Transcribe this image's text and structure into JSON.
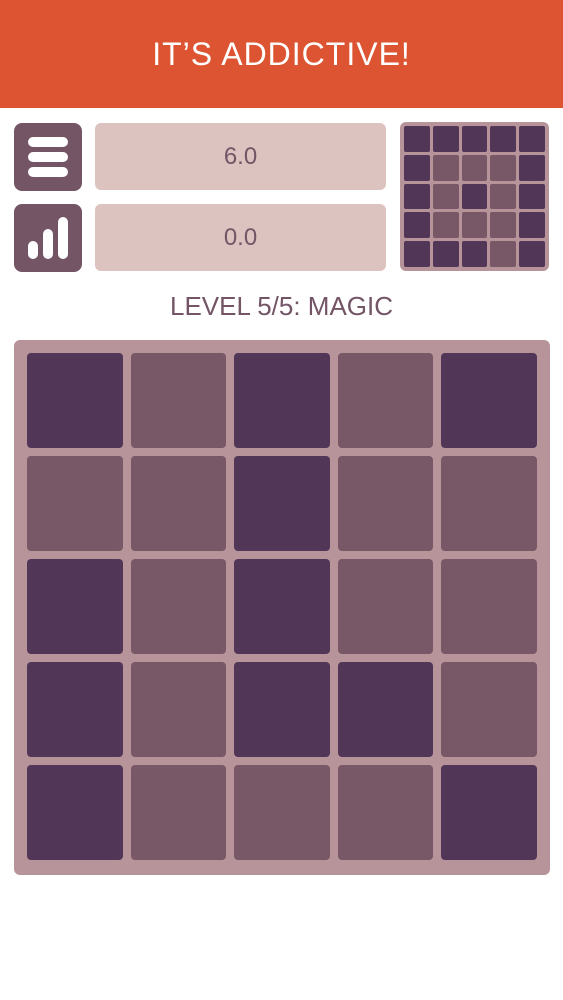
{
  "banner": {
    "text": "IT’S ADDICTIVE!"
  },
  "colors": {
    "banner_bg": "#dd5432",
    "button_bg": "#735566",
    "field_bg": "#ddc3bf",
    "text": "#735566",
    "board_bg": "#b79499",
    "dark_cell": "#523657",
    "light_cell": "#785766"
  },
  "toolbar": {
    "menu_icon": "hamburger-menu-icon",
    "stats_icon": "bar-chart-icon"
  },
  "stats": {
    "moves": "6.0",
    "score": "0.0"
  },
  "level": {
    "title": "LEVEL 5/5: MAGIC"
  },
  "preview_pattern": [
    [
      1,
      1,
      1,
      1,
      1
    ],
    [
      1,
      0,
      0,
      0,
      1
    ],
    [
      1,
      0,
      1,
      0,
      1
    ],
    [
      1,
      0,
      0,
      0,
      1
    ],
    [
      1,
      1,
      1,
      0,
      1
    ]
  ],
  "board": [
    [
      1,
      0,
      1,
      0,
      1
    ],
    [
      0,
      0,
      1,
      0,
      0
    ],
    [
      1,
      0,
      1,
      0,
      0
    ],
    [
      1,
      0,
      1,
      1,
      0
    ],
    [
      1,
      0,
      0,
      0,
      1
    ]
  ]
}
